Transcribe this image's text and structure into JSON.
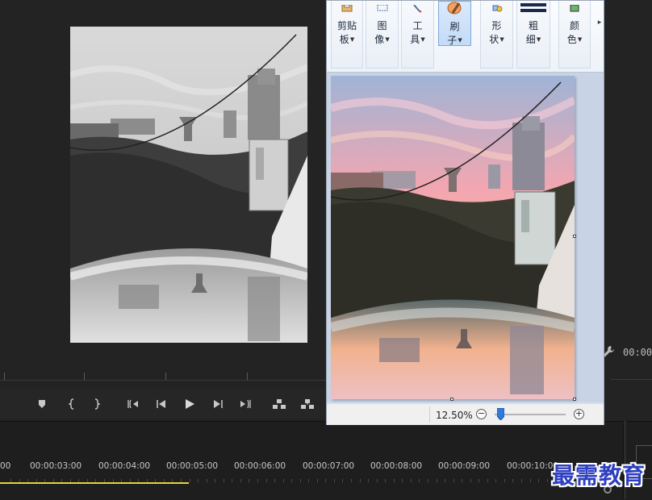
{
  "monitor": {
    "timecode": "00:00"
  },
  "timeline": {
    "timecodes": [
      "00",
      "00:00:03:00",
      "00:00:04:00",
      "00:00:05:00",
      "00:00:06:00",
      "00:00:07:00",
      "00:00:08:00",
      "00:00:09:00",
      "00:00:10:00"
    ]
  },
  "paint": {
    "ribbon": {
      "clipboard": [
        "剪贴",
        "板"
      ],
      "image": [
        "图",
        "像"
      ],
      "tools": [
        "工",
        "具"
      ],
      "brushes": [
        "刷",
        "子"
      ],
      "shapes": [
        "形",
        "状"
      ],
      "size": [
        "粗",
        "细"
      ],
      "colors": [
        "颜",
        "色"
      ],
      "more": "▸"
    },
    "status": {
      "zoom": "12.50%",
      "zoom_fraction": 0.08,
      "zoom_out": "−",
      "zoom_in": "+"
    }
  },
  "watermark": "最需教育",
  "colors": {
    "premiere_bg": "#232323",
    "ribbon_bg": "#eef3f9",
    "canvas_bg": "#c8d4e5",
    "work_area": "#e6d23c",
    "watermark": "#2e3fbf"
  },
  "icons": [
    "wrench-icon",
    "marker-icon",
    "mark-in-icon",
    "mark-out-icon",
    "go-to-in-icon",
    "step-back-icon",
    "play-icon",
    "step-forward-icon",
    "go-to-out-icon",
    "lift-icon",
    "extract-icon",
    "clipboard-icon",
    "select-icon",
    "tools-icon",
    "brush-icon",
    "shapes-icon",
    "size-icon",
    "color-icon",
    "zoom-out-icon",
    "zoom-in-icon"
  ]
}
